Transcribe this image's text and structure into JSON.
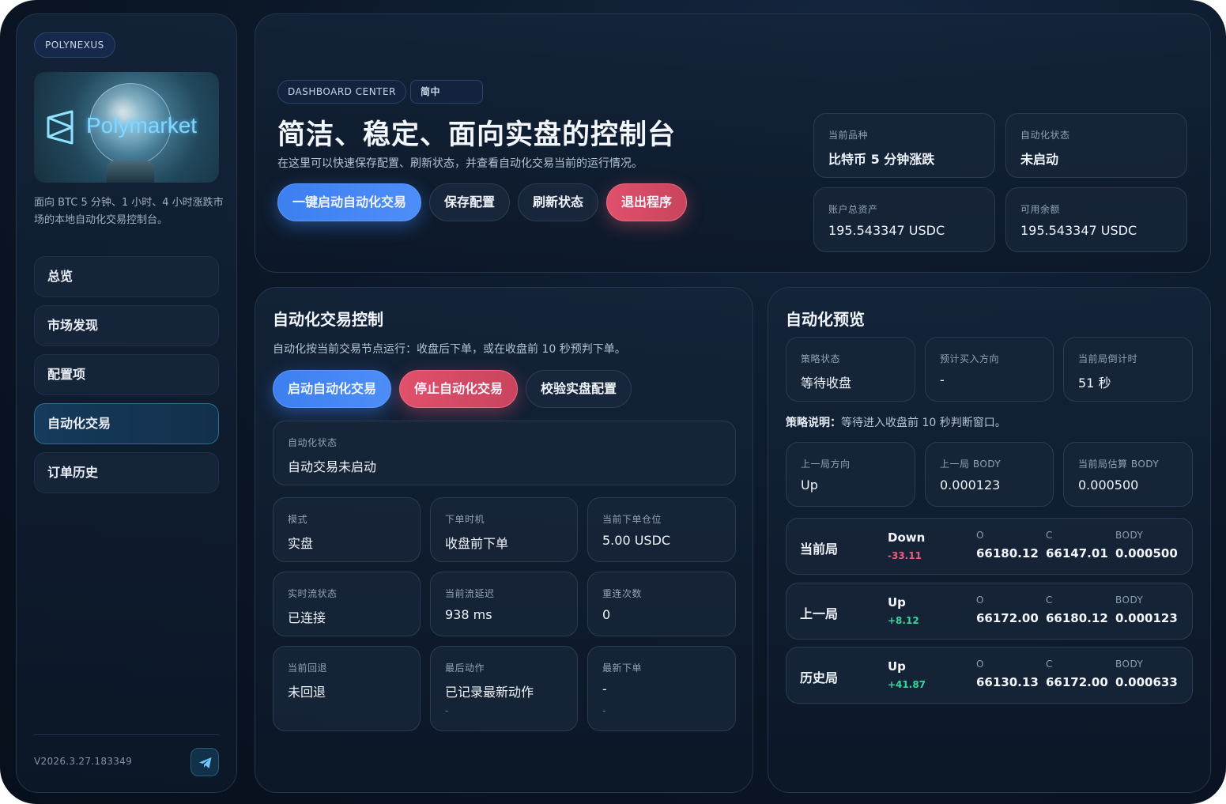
{
  "sidebar": {
    "brand": "POLYNEXUS",
    "logo_text": "Polymarket",
    "description": "面向 BTC 5 分钟、1 小时、4 小时涨跌市场的本地自动化交易控制台。",
    "nav": [
      {
        "label": "总览"
      },
      {
        "label": "市场发现"
      },
      {
        "label": "配置项"
      },
      {
        "label": "自动化交易",
        "active": true
      },
      {
        "label": "订单历史"
      }
    ],
    "version": "V2026.3.27.183349",
    "telegram_icon": "telegram-icon"
  },
  "header": {
    "tag": "DASHBOARD CENTER",
    "lang": "简中",
    "title": "简洁、稳定、面向实盘的控制台",
    "subtitle": "在这里可以快速保存配置、刷新状态，并查看自动化交易当前的运行情况。",
    "buttons": {
      "start": "一键启动自动化交易",
      "save": "保存配置",
      "refresh": "刷新状态",
      "exit": "退出程序"
    },
    "stats": [
      {
        "label": "当前品种",
        "value": "比特币 5 分钟涨跌"
      },
      {
        "label": "自动化状态",
        "value": "未启动"
      },
      {
        "label": "账户总资产",
        "value": "195.543347 USDC"
      },
      {
        "label": "可用余额",
        "value": "195.543347 USDC"
      }
    ]
  },
  "control": {
    "title": "自动化交易控制",
    "desc": "自动化按当前交易节点运行：收盘后下单，或在收盘前 10 秒预判下单。",
    "buttons": {
      "start": "启动自动化交易",
      "stop": "停止自动化交易",
      "verify": "校验实盘配置"
    },
    "status": {
      "label": "自动化状态",
      "value": "自动交易未启动"
    },
    "cards": [
      {
        "label": "模式",
        "value": "实盘"
      },
      {
        "label": "下单时机",
        "value": "收盘前下单"
      },
      {
        "label": "当前下单仓位",
        "value": "5.00 USDC"
      },
      {
        "label": "实时流状态",
        "value": "已连接"
      },
      {
        "label": "当前流延迟",
        "value": "938 ms"
      },
      {
        "label": "重连次数",
        "value": "0"
      },
      {
        "label": "当前回退",
        "value": "未回退"
      },
      {
        "label": "最后动作",
        "value": "已记录最新动作",
        "sub": "-"
      },
      {
        "label": "最新下单",
        "value": "-",
        "sub": "-"
      }
    ]
  },
  "preview": {
    "title": "自动化预览",
    "top_cards": [
      {
        "label": "策略状态",
        "value": "等待收盘"
      },
      {
        "label": "预计买入方向",
        "value": "-"
      },
      {
        "label": "当前局倒计时",
        "value": "51 秒"
      }
    ],
    "note_label": "策略说明：",
    "note_text": "等待进入收盘前 10 秒判断窗口。",
    "mid_cards": [
      {
        "label": "上一局方向",
        "value": "Up"
      },
      {
        "label": "上一局 BODY",
        "value": "0.000123"
      },
      {
        "label": "当前局估算 BODY",
        "value": "0.000500"
      }
    ],
    "rounds": [
      {
        "name": "当前局",
        "dir": "Down",
        "change": "-33.11",
        "o_label": "O",
        "o": "66180.12",
        "c_label": "C",
        "c": "66147.01",
        "body_label": "BODY",
        "body": "0.000500"
      },
      {
        "name": "上一局",
        "dir": "Up",
        "change": "+8.12",
        "o_label": "O",
        "o": "66172.00",
        "c_label": "C",
        "c": "66180.12",
        "body_label": "BODY",
        "body": "0.000123"
      },
      {
        "name": "历史局",
        "dir": "Up",
        "change": "+41.87",
        "o_label": "O",
        "o": "66130.13",
        "c_label": "C",
        "c": "66172.00",
        "body_label": "BODY",
        "body": "0.000633"
      }
    ]
  },
  "colors": {
    "accent_blue": "#3d7ff0",
    "danger_red": "#e0506b",
    "positive_green": "#39d49a",
    "negative_red": "#f05d7a"
  }
}
